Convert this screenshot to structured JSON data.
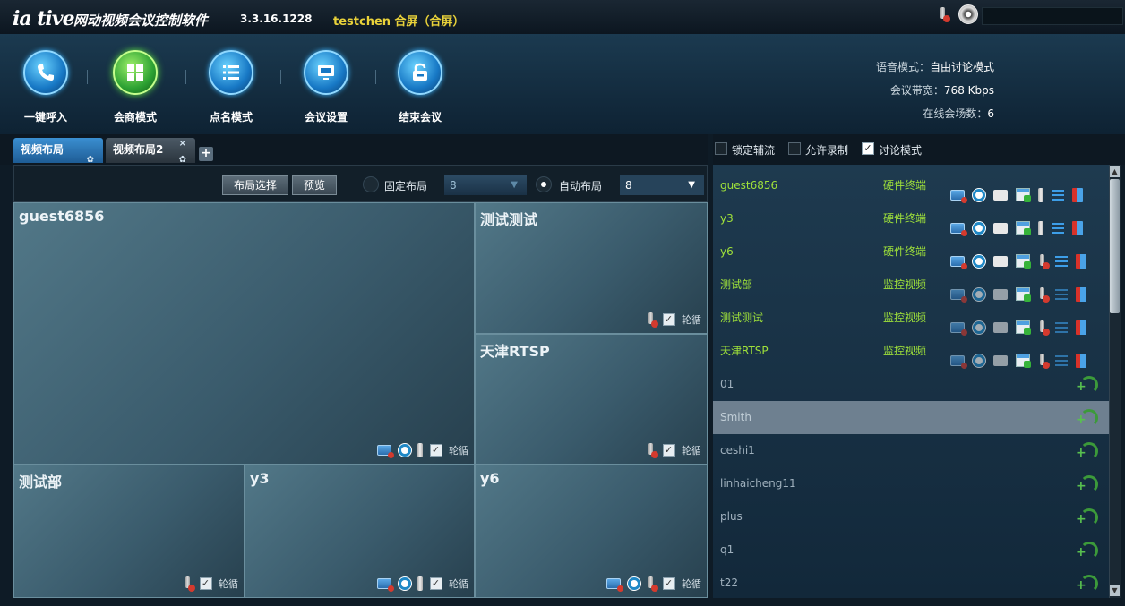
{
  "titlebar": {
    "logo": "ia tive",
    "app_name": "网动视频会议控制软件",
    "version": "3.3.16.1228",
    "user": "testchen 合屏（合屏）",
    "minimize": "—",
    "close": "×"
  },
  "toolbar": {
    "buttons": [
      {
        "label": "一键呼入",
        "icon": "phone-icon"
      },
      {
        "label": "会商模式",
        "icon": "grid-icon"
      },
      {
        "label": "点名模式",
        "icon": "list-icon"
      },
      {
        "label": "会议设置",
        "icon": "monitor-icon"
      },
      {
        "label": "结束会议",
        "icon": "unlock-icon"
      }
    ]
  },
  "stats": [
    {
      "label": "语音模式：",
      "value": "自由讨论模式"
    },
    {
      "label": "会议带宽：",
      "value": "768 Kbps"
    },
    {
      "label": "在线会场数：",
      "value": "6"
    }
  ],
  "tabs": [
    {
      "label": "视频布局"
    },
    {
      "label": "视频布局2"
    }
  ],
  "layout_bar": {
    "select_btn": "布局选择",
    "preview_btn": "预览",
    "fixed_label": "固定布局",
    "fixed_value": "8",
    "auto_label": "自动布局",
    "auto_value": "8"
  },
  "panes": [
    {
      "title": "guest6856",
      "loop": "轮循"
    },
    {
      "title": "测试测试",
      "loop": "轮循"
    },
    {
      "title": "天津RTSP",
      "loop": "轮循"
    },
    {
      "title": "测试部",
      "loop": "轮循"
    },
    {
      "title": "y3",
      "loop": "轮循"
    },
    {
      "title": "y6",
      "loop": "轮循"
    }
  ],
  "list_tools": {
    "lock_label": "锁定辅流",
    "record_label": "允许录制",
    "discuss_label": "讨论模式",
    "discuss_checked": true,
    "check_mark": "✓"
  },
  "participants": [
    {
      "name": "guest6856",
      "type": "硬件终端",
      "status": "online"
    },
    {
      "name": "y3",
      "type": "硬件终端",
      "status": "online"
    },
    {
      "name": "y6",
      "type": "硬件终端",
      "status": "online"
    },
    {
      "name": "测试部",
      "type": "监控视频",
      "status": "online"
    },
    {
      "name": "测试测试",
      "type": "监控视频",
      "status": "online"
    },
    {
      "name": "天津RTSP",
      "type": "监控视频",
      "status": "online"
    },
    {
      "name": "01",
      "type": "",
      "status": "offline"
    },
    {
      "name": "Smith",
      "type": "",
      "status": "selected"
    },
    {
      "name": "ceshi1",
      "type": "",
      "status": "offline"
    },
    {
      "name": "linhaicheng11",
      "type": "",
      "status": "offline"
    },
    {
      "name": "plus",
      "type": "",
      "status": "offline"
    },
    {
      "name": "q1",
      "type": "",
      "status": "offline"
    },
    {
      "name": "t22",
      "type": "",
      "status": "offline"
    }
  ],
  "colors": {
    "terminal_green": "#9fe13a",
    "title_yellow": "#e9d23a",
    "active_tab": "#3b8fd1"
  }
}
